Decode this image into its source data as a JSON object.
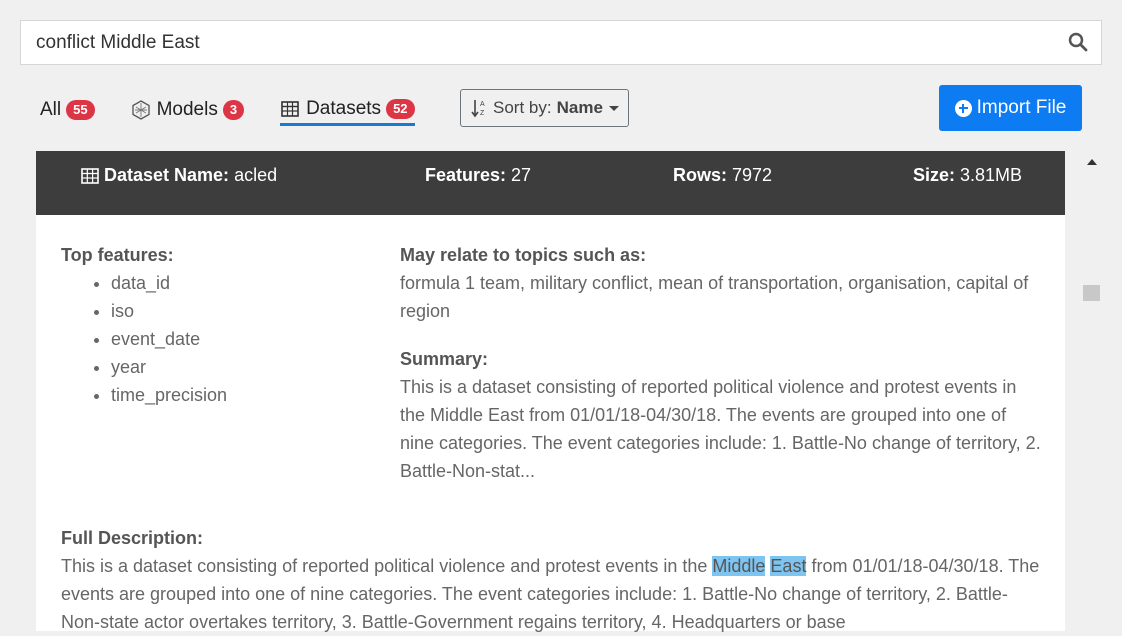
{
  "search": {
    "value": "conflict Middle East"
  },
  "tabs": [
    {
      "label": "All",
      "count": "55"
    },
    {
      "label": "Models",
      "count": "3"
    },
    {
      "label": "Datasets",
      "count": "52"
    }
  ],
  "sort": {
    "label": "Sort by:",
    "value": "Name"
  },
  "import_button": {
    "label": "Import File"
  },
  "dataset": {
    "name_label": "Dataset Name:",
    "name": "acled",
    "features_label": "Features:",
    "features": "27",
    "rows_label": "Rows:",
    "rows": "7972",
    "size_label": "Size:",
    "size": "3.81MB"
  },
  "top_features": {
    "title": "Top features:",
    "items": [
      "data_id",
      "iso",
      "event_date",
      "year",
      "time_precision"
    ]
  },
  "topics": {
    "title": "May relate to topics such as:",
    "text": "formula 1 team, military conflict, mean of transportation, organisation, capital of region"
  },
  "summary": {
    "title": "Summary:",
    "text": "This is a dataset consisting of reported political violence and protest events in the Middle East from 01/01/18-04/30/18. The events are grouped into one of nine categories. The event categories include: 1. Battle-No change of territory, 2. Battle-Non-stat..."
  },
  "full_description": {
    "title": "Full Description:",
    "before": "This is a dataset consisting of reported political violence and protest events in the ",
    "highlight1": "Middle",
    "highlight2": "East",
    "after": " from 01/01/18-04/30/18. The events are grouped into one of nine categories. The event categories include: 1. Battle-No change of territory, 2. Battle-Non-state actor overtakes territory, 3. Battle-Government regains territory, 4. Headquarters or base"
  },
  "icons": {
    "search": "search-icon",
    "models": "brain-icon",
    "datasets": "table-icon",
    "sort": "sort-alpha-icon",
    "import": "plus-circle-icon"
  },
  "colors": {
    "accent": "#0d7bf2",
    "badge": "#dc3545",
    "header_bg": "#3d3d3d",
    "highlight": "#7ec4f0"
  }
}
